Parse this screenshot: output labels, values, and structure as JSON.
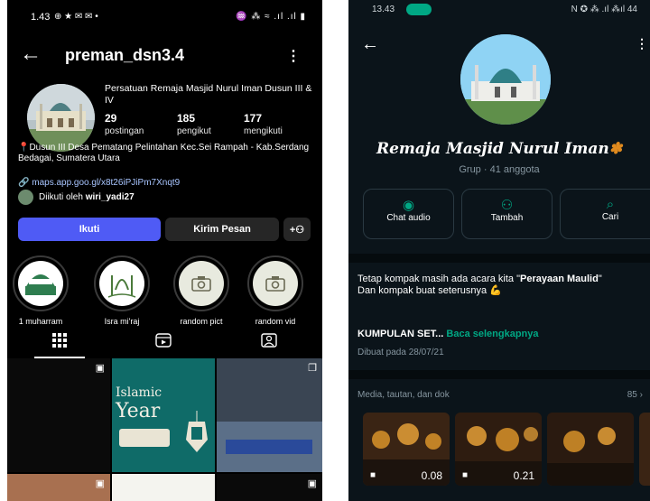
{
  "instagram": {
    "status_time": "1.43",
    "status_icons": "⊕ ★ ✉ ✉ •",
    "status_right": "♒ ⁂ ≈ .ıl .ıl ▮",
    "username": "preman_dsn3.4",
    "display_name": "Persatuan Remaja Masjid Nurul Iman Dusun III & IV",
    "stats": [
      {
        "value": "29",
        "label": "postingan"
      },
      {
        "value": "185",
        "label": "pengikut"
      },
      {
        "value": "177",
        "label": "mengikuti"
      }
    ],
    "bio": "📍Dusun III Desa Pematang Pelintahan Kec.Sei Rampah - Kab.Serdang Bedagai, Sumatera Utara",
    "link": "maps.app.goo.gl/x8t26iPJiPm7Xnqt9",
    "followed_by_prefix": "Diikuti oleh ",
    "followed_by_user": "wiri_yadi27",
    "buttons": {
      "follow": "Ikuti",
      "message": "Kirim Pesan"
    },
    "highlights": [
      {
        "label": "1 muharram",
        "icon": "1-muharram-cover"
      },
      {
        "label": "Isra mi'raj",
        "icon": "isra-miraj-cover"
      },
      {
        "label": "random pict",
        "icon": "camera-icon"
      },
      {
        "label": "random vid",
        "icon": "camera-icon"
      }
    ],
    "post_texts": {
      "islamic": "Islamic",
      "year": "Year"
    },
    "colors": {
      "follow": "#4f5bf5",
      "button_dark": "#262626",
      "link": "#a8c5ff"
    }
  },
  "whatsapp": {
    "status_time": "13.43",
    "status_icons": "N ✪ ⁂ .ıl ⁂ıl 44",
    "group_name": "Remaja Masjid Nurul Iman",
    "group_sub": "Grup · 41 anggota",
    "actions": [
      {
        "label": "Chat audio",
        "icon": "chat-audio-icon",
        "glyph": "◉"
      },
      {
        "label": "Tambah",
        "icon": "add-person-icon",
        "glyph": "⚇"
      },
      {
        "label": "Cari",
        "icon": "search-icon",
        "glyph": "⌕"
      }
    ],
    "desc_prefix": "Tetap kompak masih ada acara kita \"",
    "desc_bold": "Perayaan Maulid",
    "desc_suffix": "\"",
    "desc_line2": "Dan kompak buat seterusnya 💪",
    "kumpulan": "KUMPULAN SET...",
    "read_more": "Baca selengkapnya",
    "created": "Dibuat pada 28/07/21",
    "media_label": "Media, tautan, dan dok",
    "media_count": "85",
    "videos": [
      {
        "duration": "0.08"
      },
      {
        "duration": "0.21"
      }
    ],
    "colors": {
      "accent": "#00a884",
      "bg": "#0b141a"
    }
  }
}
